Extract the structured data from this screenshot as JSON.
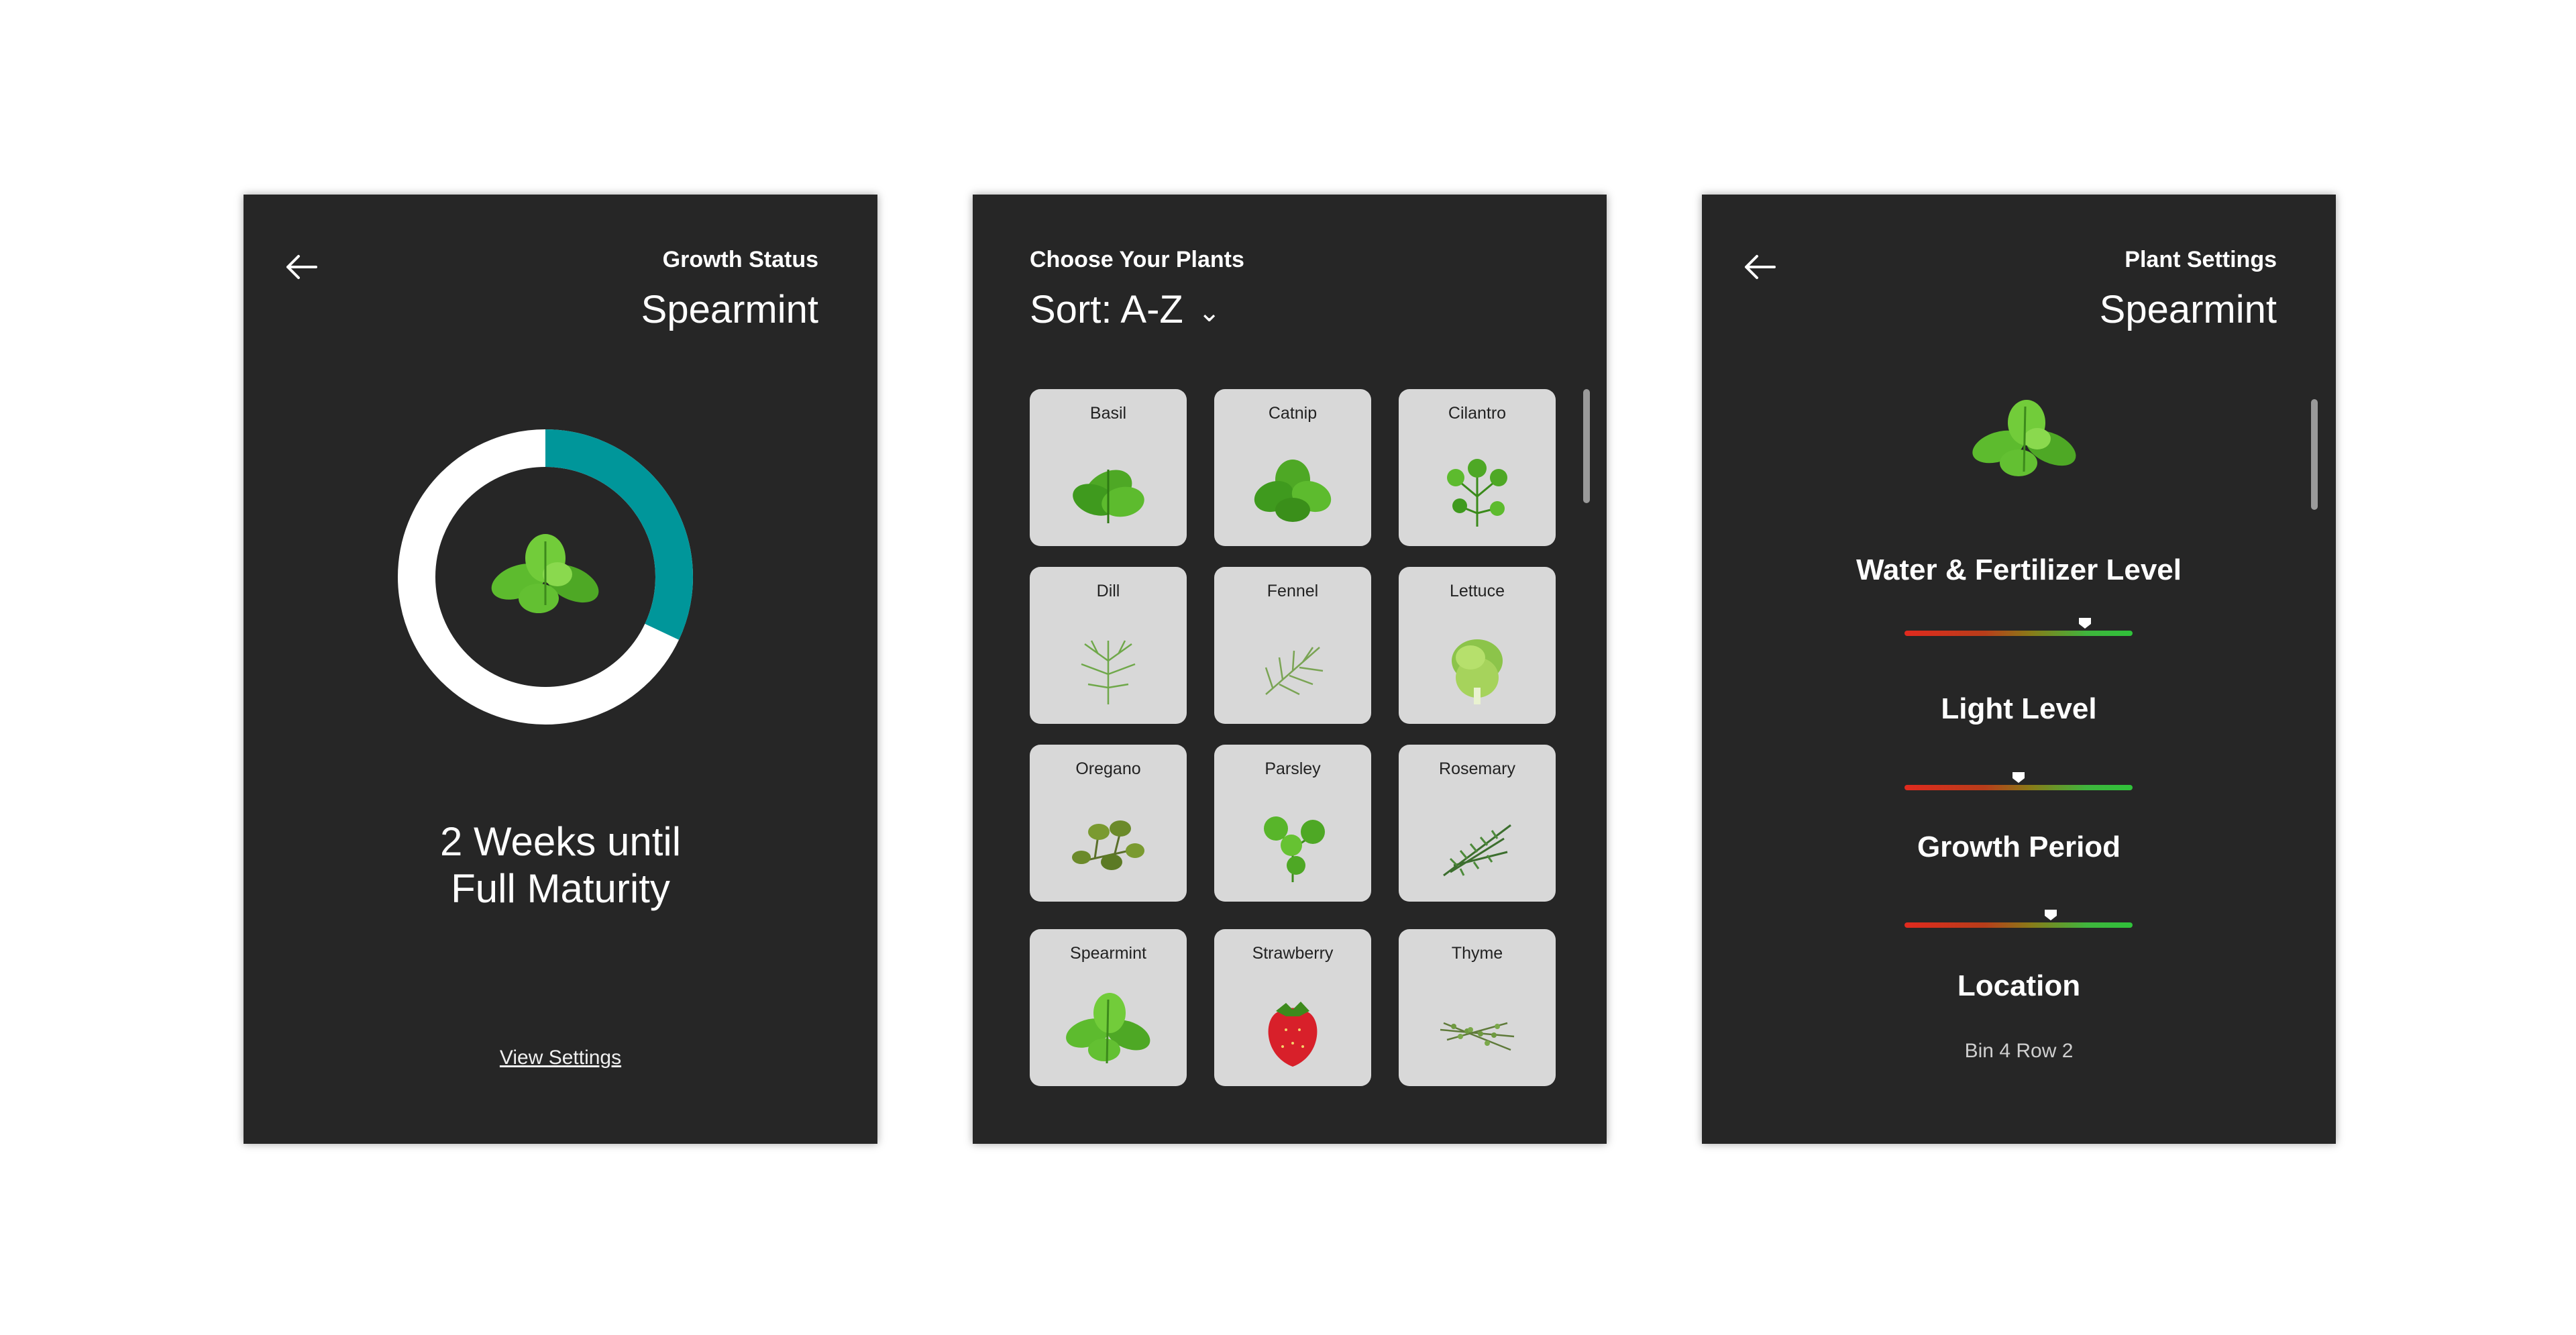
{
  "colors": {
    "panel_bg": "#262626",
    "ring_progress": "#00969a",
    "ring_track": "#ffffff",
    "tile_bg": "#d8d8d8"
  },
  "growth_status": {
    "back_icon": "arrow-left-icon",
    "title": "Growth Status",
    "plant_name": "Spearmint",
    "progress_fraction": 0.32,
    "maturity_line1": "2 Weeks until",
    "maturity_line2": "Full Maturity",
    "view_settings_link": "View Settings"
  },
  "choose_plants": {
    "title": "Choose Your Plants",
    "sort_label": "Sort: A-Z",
    "sort_icon": "chevron-down-icon",
    "plants": [
      {
        "name": "Basil",
        "icon": "basil-leaf-icon"
      },
      {
        "name": "Catnip",
        "icon": "catnip-leaf-icon"
      },
      {
        "name": "Cilantro",
        "icon": "cilantro-leaf-icon"
      },
      {
        "name": "Dill",
        "icon": "dill-icon"
      },
      {
        "name": "Fennel",
        "icon": "fennel-icon"
      },
      {
        "name": "Lettuce",
        "icon": "lettuce-icon"
      },
      {
        "name": "Oregano",
        "icon": "oregano-icon"
      },
      {
        "name": "Parsley",
        "icon": "parsley-icon"
      },
      {
        "name": "Rosemary",
        "icon": "rosemary-icon"
      },
      {
        "name": "Spearmint",
        "icon": "spearmint-icon"
      },
      {
        "name": "Strawberry",
        "icon": "strawberry-icon"
      },
      {
        "name": "Thyme",
        "icon": "thyme-icon"
      }
    ]
  },
  "plant_settings": {
    "back_icon": "arrow-left-icon",
    "title": "Plant Settings",
    "plant_name": "Spearmint",
    "water_label": "Water & Fertilizer Level",
    "water_level": 0.79,
    "light_label": "Light Level",
    "light_level": 0.5,
    "growth_label": "Growth Period",
    "growth_level": 0.64,
    "location_label": "Location",
    "location_value": "Bin 4 Row 2"
  }
}
